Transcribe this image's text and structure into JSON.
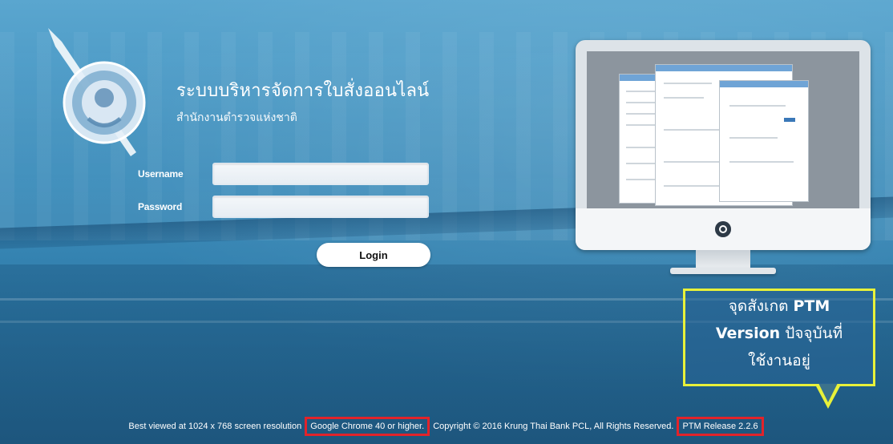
{
  "app": {
    "title": "ระบบบริหารจัดการใบสั่งออนไลน์",
    "subtitle": "สำนักงานตำรวจแห่งชาติ"
  },
  "login_form": {
    "username_label": "Username",
    "username_value": "",
    "password_label": "Password",
    "password_value": "",
    "login_button": "Login"
  },
  "footer": {
    "best_viewed": "Best viewed at 1024 x 768 screen resolution",
    "browser": "Google Chrome 40 or higher.",
    "copyright": "Copyright © 2016 Krung Thai Bank PCL, All Rights Reserved.",
    "release": "PTM Release 2.2.6"
  },
  "callout": {
    "line1_prefix": "จุดสังเกต",
    "line1_bold": "PTM",
    "line2_bold": "Version",
    "line2_suffix": "ปัจจุบันที่",
    "line3": "ใช้งานอยู่"
  },
  "colors": {
    "background": "#3f8fbf",
    "highlight_red": "#e2232a",
    "callout_yellow": "#e8f13a"
  },
  "icons": {
    "logo": "royal-thai-police-seal",
    "monitor": "desktop-monitor-illustration"
  }
}
